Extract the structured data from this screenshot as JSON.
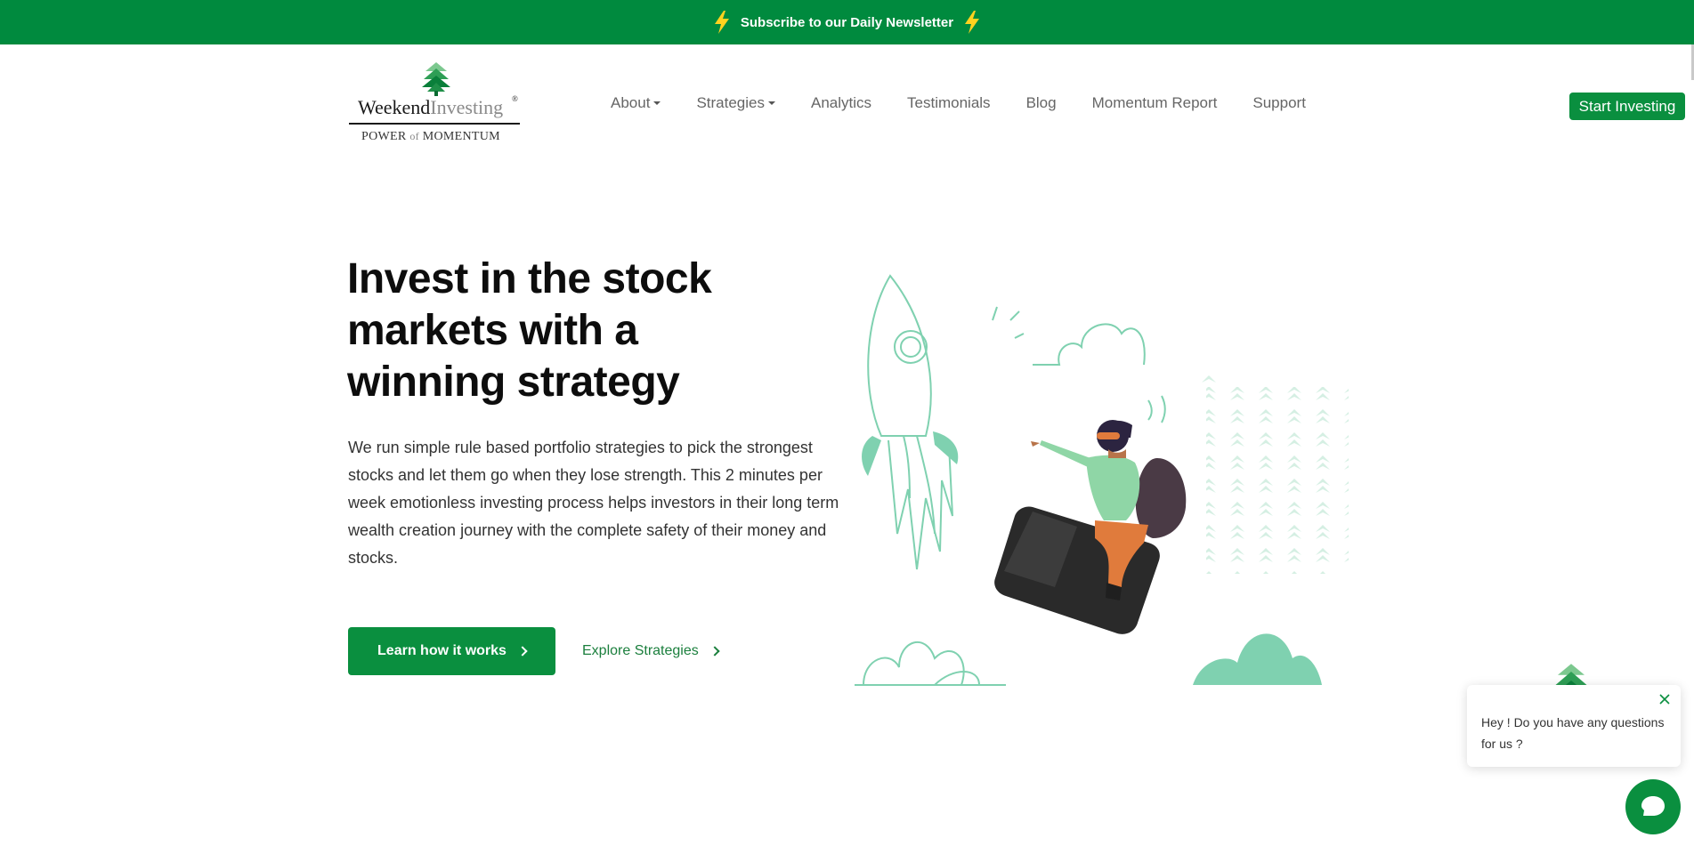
{
  "banner": {
    "text": "Subscribe to our Daily Newsletter"
  },
  "logo": {
    "word_part1": "Weekend",
    "word_part2": "Investing",
    "reg": "®",
    "tag_part1": "POWER",
    "tag_part2": "of",
    "tag_part3": "MOMENTUM"
  },
  "nav": {
    "items": [
      {
        "label": "About",
        "dropdown": true
      },
      {
        "label": "Strategies",
        "dropdown": true
      },
      {
        "label": "Analytics"
      },
      {
        "label": "Testimonials"
      },
      {
        "label": "Blog"
      },
      {
        "label": "Momentum Report"
      },
      {
        "label": "Support"
      }
    ],
    "cta": "Start Investing"
  },
  "hero": {
    "title_line1": "Invest in the stock",
    "title_line2": "markets with a",
    "title_line3": "winning strategy",
    "description": "We run simple rule based portfolio strategies to pick the strongest stocks and let them go when they lose strength. This 2 minutes per week emotionless investing process helps investors in their long term wealth creation journey with the complete safety of their money and stocks.",
    "primary_button": "Learn how it works",
    "secondary_link": "Explore Strategies"
  },
  "chat": {
    "message": "Hey ! Do you have any questions for us ?"
  },
  "colors": {
    "brand_green": "#0a8f3f",
    "banner_green": "#008a3e",
    "mint": "#7fd1b0"
  }
}
